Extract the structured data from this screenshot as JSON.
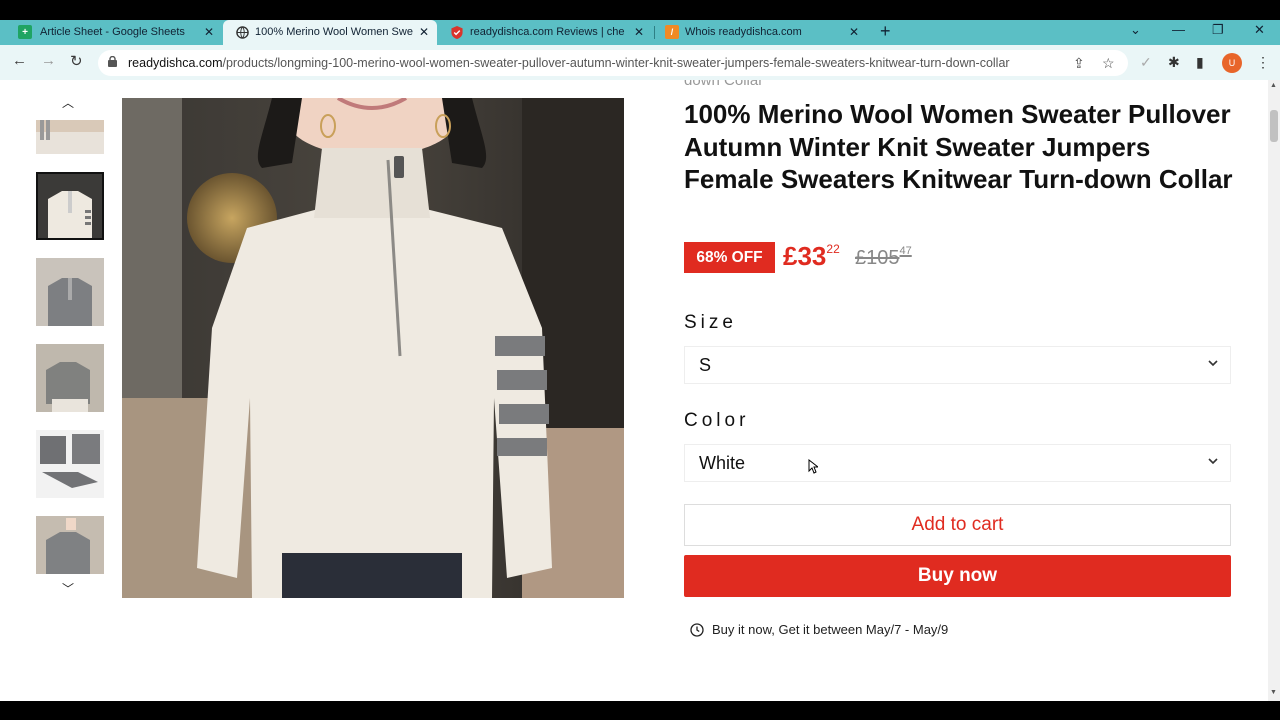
{
  "browser": {
    "tabs": [
      {
        "title": "Article Sheet - Google Sheets",
        "favicon": "sheets-icon"
      },
      {
        "title": "100% Merino Wool Women Swe",
        "favicon": "globe-icon",
        "active": true
      },
      {
        "title": "readydishca.com Reviews | check",
        "favicon": "shield-icon"
      },
      {
        "title": "Whois readydishca.com",
        "favicon": "whois-icon"
      }
    ],
    "url_domain": "readydishca.com",
    "url_path": "/products/longming-100-merino-wool-women-sweater-pullover-autumn-winter-knit-sweater-jumpers-female-sweaters-knitwear-turn-down-collar",
    "avatar_letter": "U"
  },
  "product": {
    "partial_title_above": "down Collar",
    "title": "100% Merino Wool Women Sweater Pullover Autumn Winter Knit Sweater Jumpers Female Sweaters Knitwear Turn-down Collar",
    "discount_badge": "68% OFF",
    "price_main": "£33",
    "price_cents": "22",
    "old_price_main": "£105",
    "old_price_cents": "47",
    "size_label": "Size",
    "size_value": "S",
    "color_label": "Color",
    "color_value": "White",
    "add_to_cart": "Add to cart",
    "buy_now": "Buy now",
    "delivery_text": "Buy it now, Get it between May/7 - May/9"
  },
  "colors": {
    "accent_red": "#e02b20",
    "tabstrip": "#5bbfc5"
  }
}
